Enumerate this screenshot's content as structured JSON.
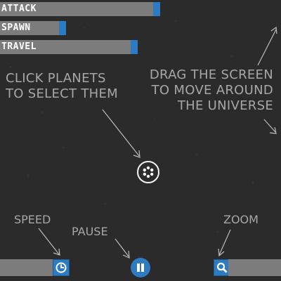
{
  "stats": {
    "attack": {
      "label": "ATTACK",
      "level": 0.57
    },
    "spawn": {
      "label": "SPAWN",
      "level": 0.23
    },
    "travel": {
      "label": "TRAVEL",
      "level": 0.49
    }
  },
  "hints": {
    "click_line1": "CLICK PLANETS",
    "click_line2": "TO SELECT THEM",
    "drag_line1": "DRAG THE SCREEN",
    "drag_line2": "TO MOVE AROUND",
    "drag_line3": "THE UNIVERSE"
  },
  "controls": {
    "speed_label": "SPEED",
    "pause_label": "PAUSE",
    "zoom_label": "ZOOM"
  },
  "colors": {
    "background": "#2b2b2b",
    "bar": "#7c7c7c",
    "accent": "#2d7bc0",
    "text": "#a7a7a7"
  },
  "icons": {
    "speed": "clock-icon",
    "pause": "pause-icon",
    "zoom": "magnifier-icon",
    "planet": "planet-icon"
  }
}
